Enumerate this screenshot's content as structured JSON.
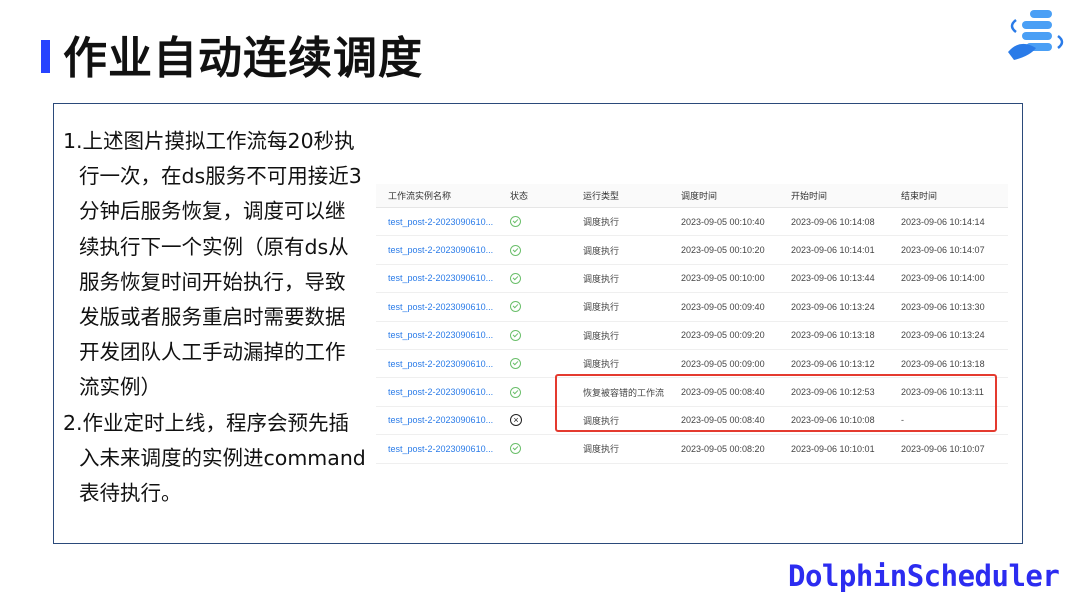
{
  "title": "作业自动连续调度",
  "description_lines": [
    "1.上述图片摸拟工作流每20秒执",
    "行一次，在ds服务不可用接近3",
    "分钟后服务恢复，调度可以继",
    "续执行下一个实例（原有ds从",
    "服务恢复时间开始执行，导致",
    "发版或者服务重启时需要数据",
    "开发团队人工手动漏掉的工作",
    "流实例）",
    "2.作业定时上线，程序会预先插",
    "入未来调度的实例进command",
    "表待执行。"
  ],
  "table": {
    "headers": [
      "工作流实例名称",
      "状态",
      "运行类型",
      "调度时间",
      "开始时间",
      "结束时间"
    ],
    "rows": [
      {
        "name": "test_post-2-2023090610...",
        "status": "success",
        "type": "调度执行",
        "schedule": "2023-09-05 00:10:40",
        "start": "2023-09-06 10:14:08",
        "end": "2023-09-06 10:14:14"
      },
      {
        "name": "test_post-2-2023090610...",
        "status": "success",
        "type": "调度执行",
        "schedule": "2023-09-05 00:10:20",
        "start": "2023-09-06 10:14:01",
        "end": "2023-09-06 10:14:07"
      },
      {
        "name": "test_post-2-2023090610...",
        "status": "success",
        "type": "调度执行",
        "schedule": "2023-09-05 00:10:00",
        "start": "2023-09-06 10:13:44",
        "end": "2023-09-06 10:14:00"
      },
      {
        "name": "test_post-2-2023090610...",
        "status": "success",
        "type": "调度执行",
        "schedule": "2023-09-05 00:09:40",
        "start": "2023-09-06 10:13:24",
        "end": "2023-09-06 10:13:30"
      },
      {
        "name": "test_post-2-2023090610...",
        "status": "success",
        "type": "调度执行",
        "schedule": "2023-09-05 00:09:20",
        "start": "2023-09-06 10:13:18",
        "end": "2023-09-06 10:13:24"
      },
      {
        "name": "test_post-2-2023090610...",
        "status": "success",
        "type": "调度执行",
        "schedule": "2023-09-05 00:09:00",
        "start": "2023-09-06 10:13:12",
        "end": "2023-09-06 10:13:18"
      },
      {
        "name": "test_post-2-2023090610...",
        "status": "success",
        "type": "恢复被容错的工作流",
        "schedule": "2023-09-05 00:08:40",
        "start": "2023-09-06 10:12:53",
        "end": "2023-09-06 10:13:11"
      },
      {
        "name": "test_post-2-2023090610...",
        "status": "failed",
        "type": "调度执行",
        "schedule": "2023-09-05 00:08:40",
        "start": "2023-09-06 10:10:08",
        "end": "-"
      },
      {
        "name": "test_post-2-2023090610...",
        "status": "success",
        "type": "调度执行",
        "schedule": "2023-09-05 00:08:20",
        "start": "2023-09-06 10:10:01",
        "end": "2023-09-06 10:10:07"
      }
    ]
  },
  "brand": "DolphinScheduler",
  "colors": {
    "accent": "#2743ff",
    "brand": "#2c2cf0",
    "highlight": "#e43a2f",
    "link": "#2a7be8",
    "success": "#6bbf6b"
  }
}
